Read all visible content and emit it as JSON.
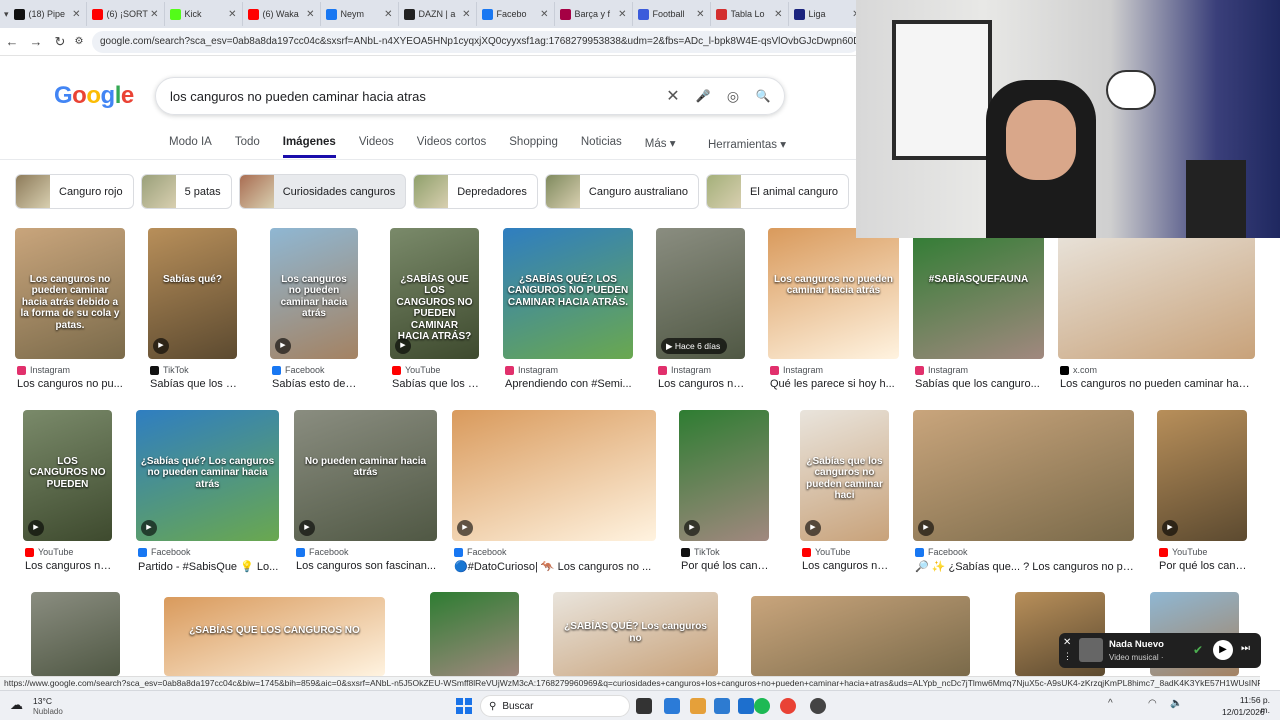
{
  "browser": {
    "tabs": [
      {
        "label": "(18) Pipe",
        "color": "#111111"
      },
      {
        "label": "(6) ¡SORT",
        "color": "#ff0000"
      },
      {
        "label": "Kick",
        "color": "#53fc18"
      },
      {
        "label": "(6) Waka",
        "color": "#ff0000"
      },
      {
        "label": "Neym",
        "color": "#1877f2"
      },
      {
        "label": "DAZN | a",
        "color": "#222222"
      },
      {
        "label": "Facebo",
        "color": "#1877f2"
      },
      {
        "label": "Barça y f",
        "color": "#a50044"
      },
      {
        "label": "Football",
        "color": "#3b5bdb"
      },
      {
        "label": "Tabla Lo",
        "color": "#d32f2f"
      },
      {
        "label": "Liga",
        "color": "#1a237e"
      }
    ],
    "url": "google.com/search?sca_esv=0ab8a8da197cc04c&sxsrf=ANbL-n4XYEOA5HNp1cyqxjXQ0cyyxsf1ag:1768279953838&udm=2&fbs=ADc_l-bpk8W4E-qsVlOvbGJcDwpn60DczFdcvPnuv8W"
  },
  "search": {
    "query": "los canguros no pueden caminar hacia atras",
    "clear_icon": "✕",
    "mic_icon": "🎤",
    "lens_icon": "◎",
    "search_icon": "🔍"
  },
  "logo": [
    "G",
    "o",
    "o",
    "g",
    "l",
    "e"
  ],
  "nav_tabs": [
    "Modo IA",
    "Todo",
    "Imágenes",
    "Videos",
    "Videos cortos",
    "Shopping",
    "Noticias",
    "Más ▾"
  ],
  "tools_label": "Herramientas ▾",
  "chips": [
    {
      "label": "Canguro rojo"
    },
    {
      "label": "5 patas"
    },
    {
      "label": "Curiosidades canguros"
    },
    {
      "label": "Depredadores"
    },
    {
      "label": "Canguro australiano"
    },
    {
      "label": "El animal canguro"
    }
  ],
  "row1": [
    {
      "source": "Instagram",
      "caption": "Los canguros no pu...",
      "overlay": "Los canguros no pueden caminar hacia atrás debido a la forma de su cola y patas."
    },
    {
      "source": "TikTok",
      "caption": "Sabías que los can...",
      "overlay": "Sabías qué?"
    },
    {
      "source": "Facebook",
      "caption": "Sabías esto de los ...",
      "overlay": "Los canguros no pueden caminar hacia atrás"
    },
    {
      "source": "YouTube",
      "caption": "Sabías que los Ca...",
      "overlay": "¿SABÍAS QUE LOS CANGUROS NO PUEDEN CAMINAR HACIA ATRÁS?"
    },
    {
      "source": "Instagram",
      "caption": "Aprendiendo con #Semi...",
      "overlay": "¿SABÍAS QUÉ? LOS CANGUROS NO PUEDEN CAMINAR HACIA ATRÁS."
    },
    {
      "source": "Instagram",
      "caption": "Los canguros no p...",
      "badge": "Hace 6 días"
    },
    {
      "source": "Instagram",
      "caption": "Qué les parece si hoy h...",
      "overlay": "Los canguros no pueden caminar hacia atrás"
    },
    {
      "source": "Instagram",
      "caption": "Sabías que los canguro...",
      "overlay": "#SABÍASQUEFAUNA"
    },
    {
      "source": "x.com",
      "caption": "Los canguros no pueden caminar haci..."
    }
  ],
  "row2": [
    {
      "source": "YouTube",
      "caption": "Los canguros no p...",
      "overlay": "LOS CANGUROS NO PUEDEN"
    },
    {
      "source": "Facebook",
      "caption": "Partido - #SabisQue 💡 Lo...",
      "overlay": "¿Sabías qué? Los canguros no pueden caminar hacia atrás"
    },
    {
      "source": "Facebook",
      "caption": "Los canguros son fascinan...",
      "overlay": "No pueden caminar hacia atrás"
    },
    {
      "source": "Facebook",
      "caption": "🔵#DatoCurioso| 🦘 Los canguros no ..."
    },
    {
      "source": "TikTok",
      "caption": "Por qué los cangur..."
    },
    {
      "source": "YouTube",
      "caption": "Los canguros no p...",
      "overlay": "¿Sabías que los canguros no pueden caminar haci"
    },
    {
      "source": "Facebook",
      "caption": "🔎 ✨ ¿Sabías que... ? Los canguros no pu..."
    },
    {
      "source": "YouTube",
      "caption": "Por qué los cangur..."
    }
  ],
  "row3": [
    {
      "overlay": ""
    },
    {
      "overlay": "¿SABÍAS QUE LOS CANGUROS NO"
    },
    {
      "overlay": ""
    },
    {
      "overlay": "¿SABÍAS QUÉ? Los canguros no"
    },
    {
      "overlay": ""
    },
    {
      "overlay": ""
    },
    {
      "overlay": ""
    }
  ],
  "status_url": "https://www.google.com/search?sca_esv=0ab8a8da197cc04c&biw=1745&bih=859&aic=0&sxsrf=ANbL-n5J5OkZEU-WSmff8lReVUjWzM3cA:1768279960969&q=curiosidades+canguros+los+canguros+no+pueden+caminar+hacia+atras&uds=ALYpb_ncDc7jTlmw6Mmq7NjuX5c-A9sUK4-zKrzqjKmPL8himc7_8adK4K3YkE57H1WUsINP0SlKNdCOxcePm7el...",
  "media_player": {
    "title": "Nada Nuevo",
    "subtitle": "Video musical ·"
  },
  "taskbar": {
    "temp": "13°C",
    "weather": "Nublado",
    "search": "Buscar",
    "time": "11:56 p. m.",
    "date": "12/01/2026"
  }
}
